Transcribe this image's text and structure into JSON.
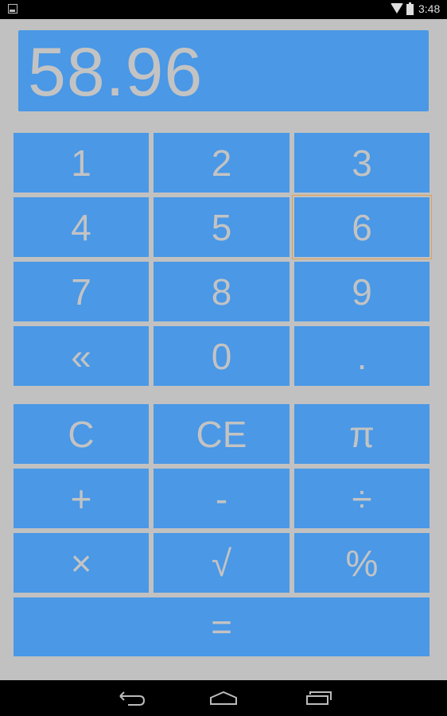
{
  "status_bar": {
    "notification_icon": "image-icon",
    "wifi_icon": "wifi-icon",
    "battery_icon": "battery-icon",
    "time": "3:48"
  },
  "display": {
    "value": "58.96"
  },
  "keypad": {
    "rows": [
      [
        "1",
        "2",
        "3"
      ],
      [
        "4",
        "5",
        "6"
      ],
      [
        "7",
        "8",
        "9"
      ],
      [
        "«",
        "0",
        "."
      ]
    ]
  },
  "operators": {
    "rows": [
      [
        "C",
        "CE",
        "π"
      ],
      [
        "+",
        "-",
        "÷"
      ],
      [
        "×",
        "√",
        "%"
      ]
    ],
    "equals": "="
  },
  "focused_key": "6",
  "colors": {
    "key_bg": "#4a98e6",
    "background": "#c1c1c1",
    "text": "#c3c3c3",
    "focus": "#e0a050"
  },
  "nav_bar": {
    "back_icon": "back-icon",
    "home_icon": "home-icon",
    "recents_icon": "recents-icon"
  }
}
